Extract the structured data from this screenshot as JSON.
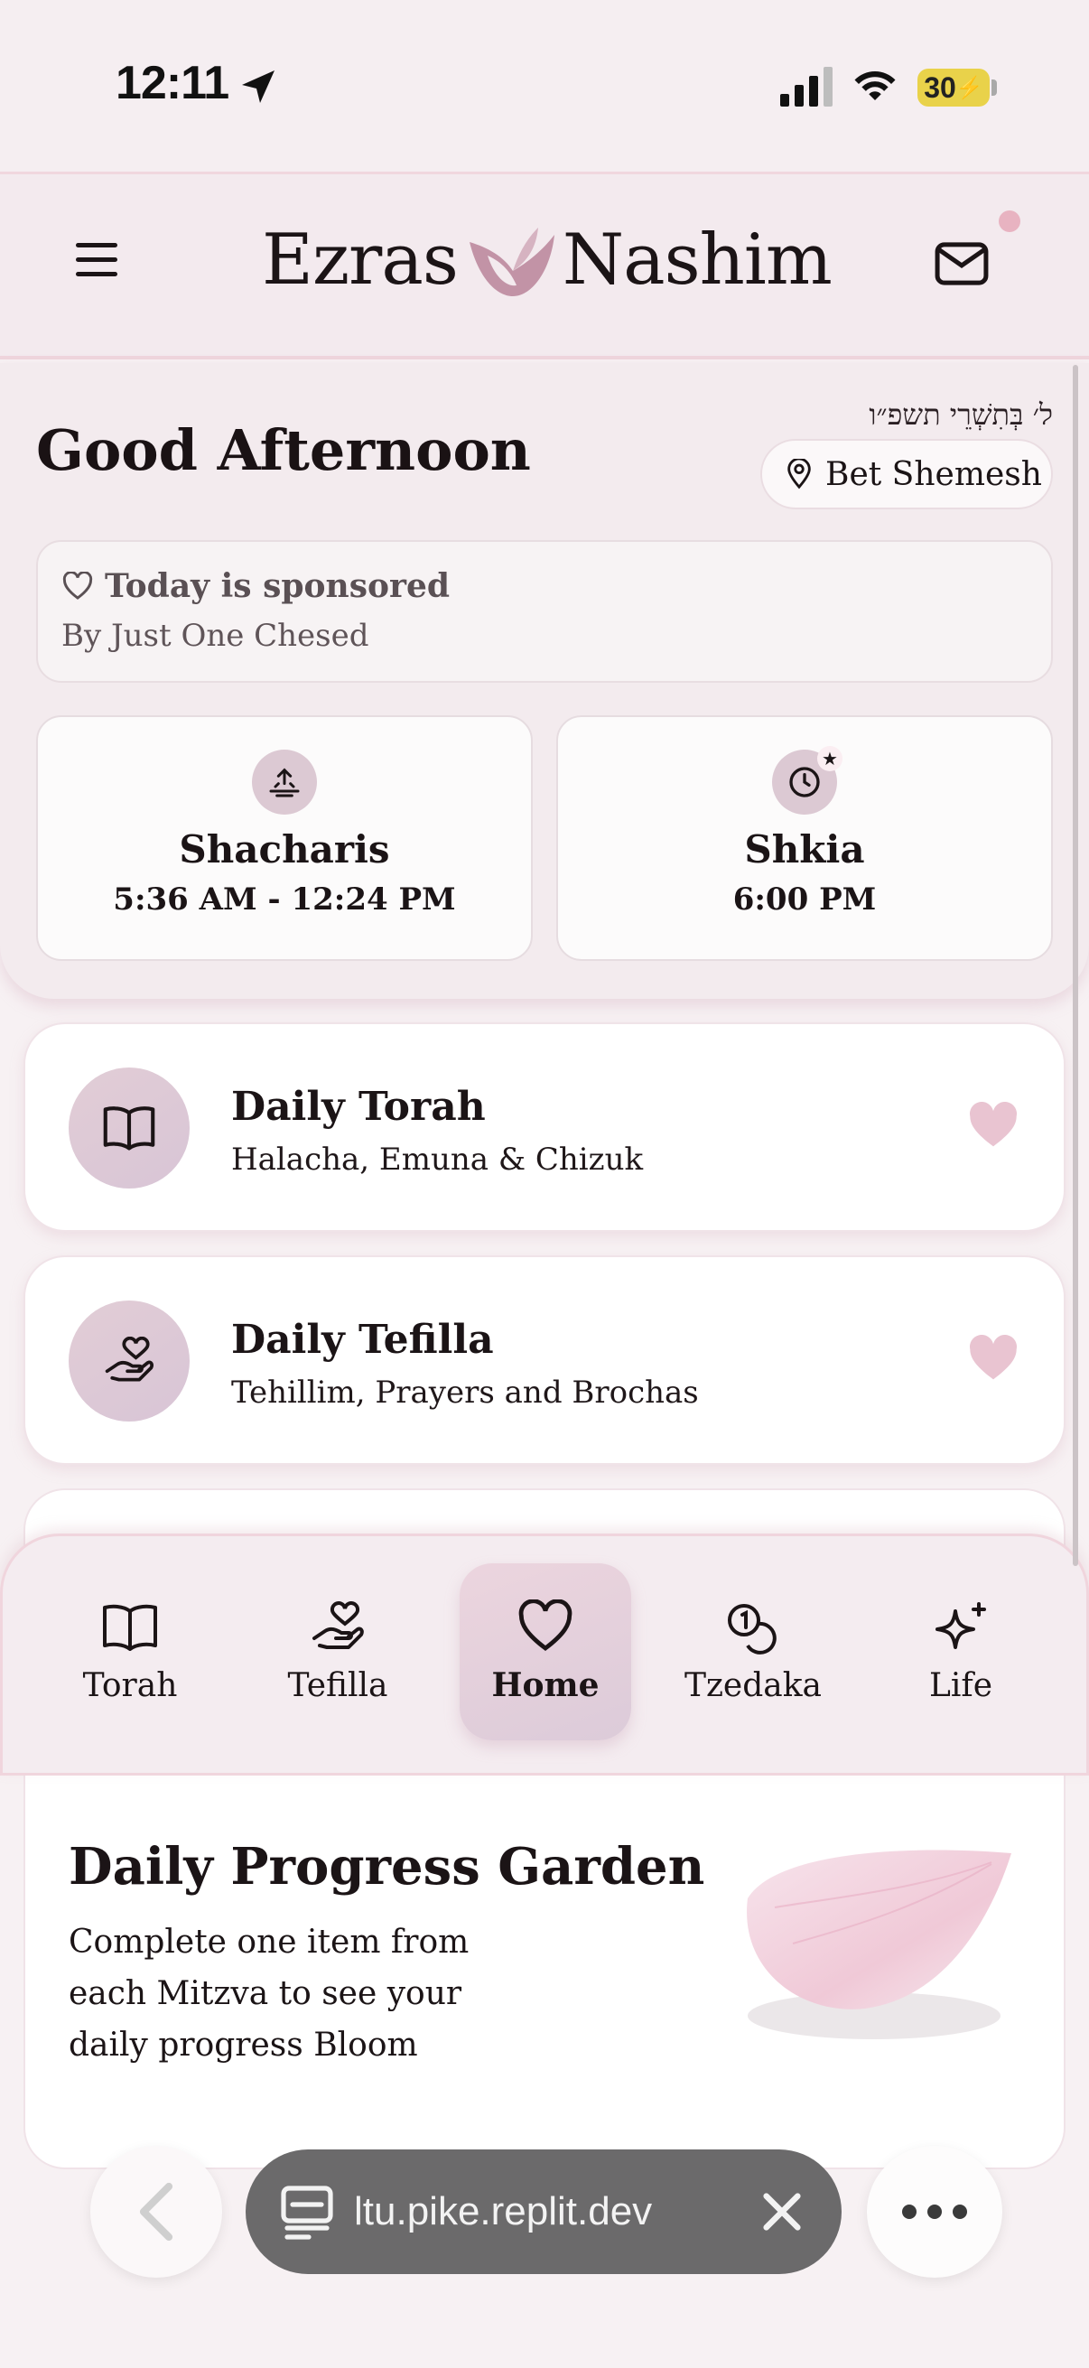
{
  "status_bar": {
    "time": "12:11",
    "battery": "30"
  },
  "header": {
    "logo_left": "Ezras",
    "logo_right": "Nashim"
  },
  "hero": {
    "hebrew_date": "ל׳ בְּתִשְׁרֵי תשפ״ו",
    "greeting": "Good Afternoon",
    "location": "Bet Shemesh",
    "sponsor_title": "Today is sponsored",
    "sponsor_sub": "By Just One Chesed",
    "times": [
      {
        "label": "Shacharis",
        "value": "5:36 AM - 12:24 PM"
      },
      {
        "label": "Shkia",
        "value": "6:00 PM"
      }
    ]
  },
  "features": [
    {
      "title": "Daily Torah",
      "subtitle": "Halacha, Emuna & Chizuk"
    },
    {
      "title": "Daily Tefilla",
      "subtitle": "Tehillim, Prayers and Brochas"
    }
  ],
  "tabs": [
    {
      "label": "Torah",
      "icon": "book-icon"
    },
    {
      "label": "Tefilla",
      "icon": "hand-heart-icon"
    },
    {
      "label": "Home",
      "icon": "heart-icon",
      "active": true
    },
    {
      "label": "Tzedaka",
      "icon": "coins-icon"
    },
    {
      "label": "Life",
      "icon": "sparkles-icon"
    }
  ],
  "garden": {
    "title": "Daily Progress Garden",
    "description": "Complete one item from each Mitzva to see your daily progress Bloom"
  },
  "browser": {
    "url": "ltu.pike.replit.dev"
  },
  "colors": {
    "accent": "#dcc9d3",
    "brand_pink": "#e8b3c1",
    "background": "#f7f1f3"
  }
}
